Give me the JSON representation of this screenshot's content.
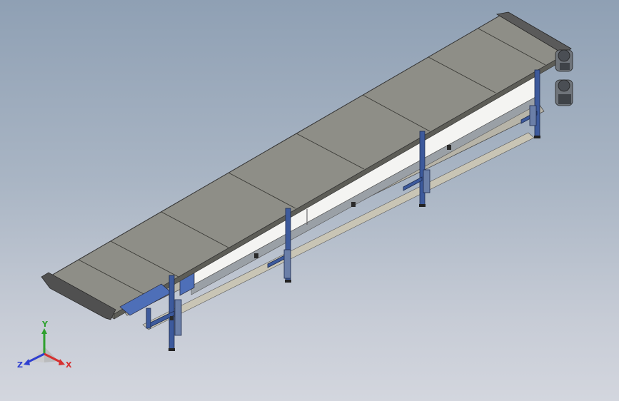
{
  "scene": {
    "background_top": "#8fa0b4",
    "background_bottom": "#d3d6de",
    "belt_color": "#8e8e87",
    "frame_color": "#3d5a9c",
    "guard_color": "#f2f2f2"
  },
  "triad": {
    "x_label": "X",
    "y_label": "Y",
    "z_label": "Z",
    "x_color": "#d63030",
    "y_color": "#2ea02e",
    "z_color": "#2f3fd0"
  }
}
